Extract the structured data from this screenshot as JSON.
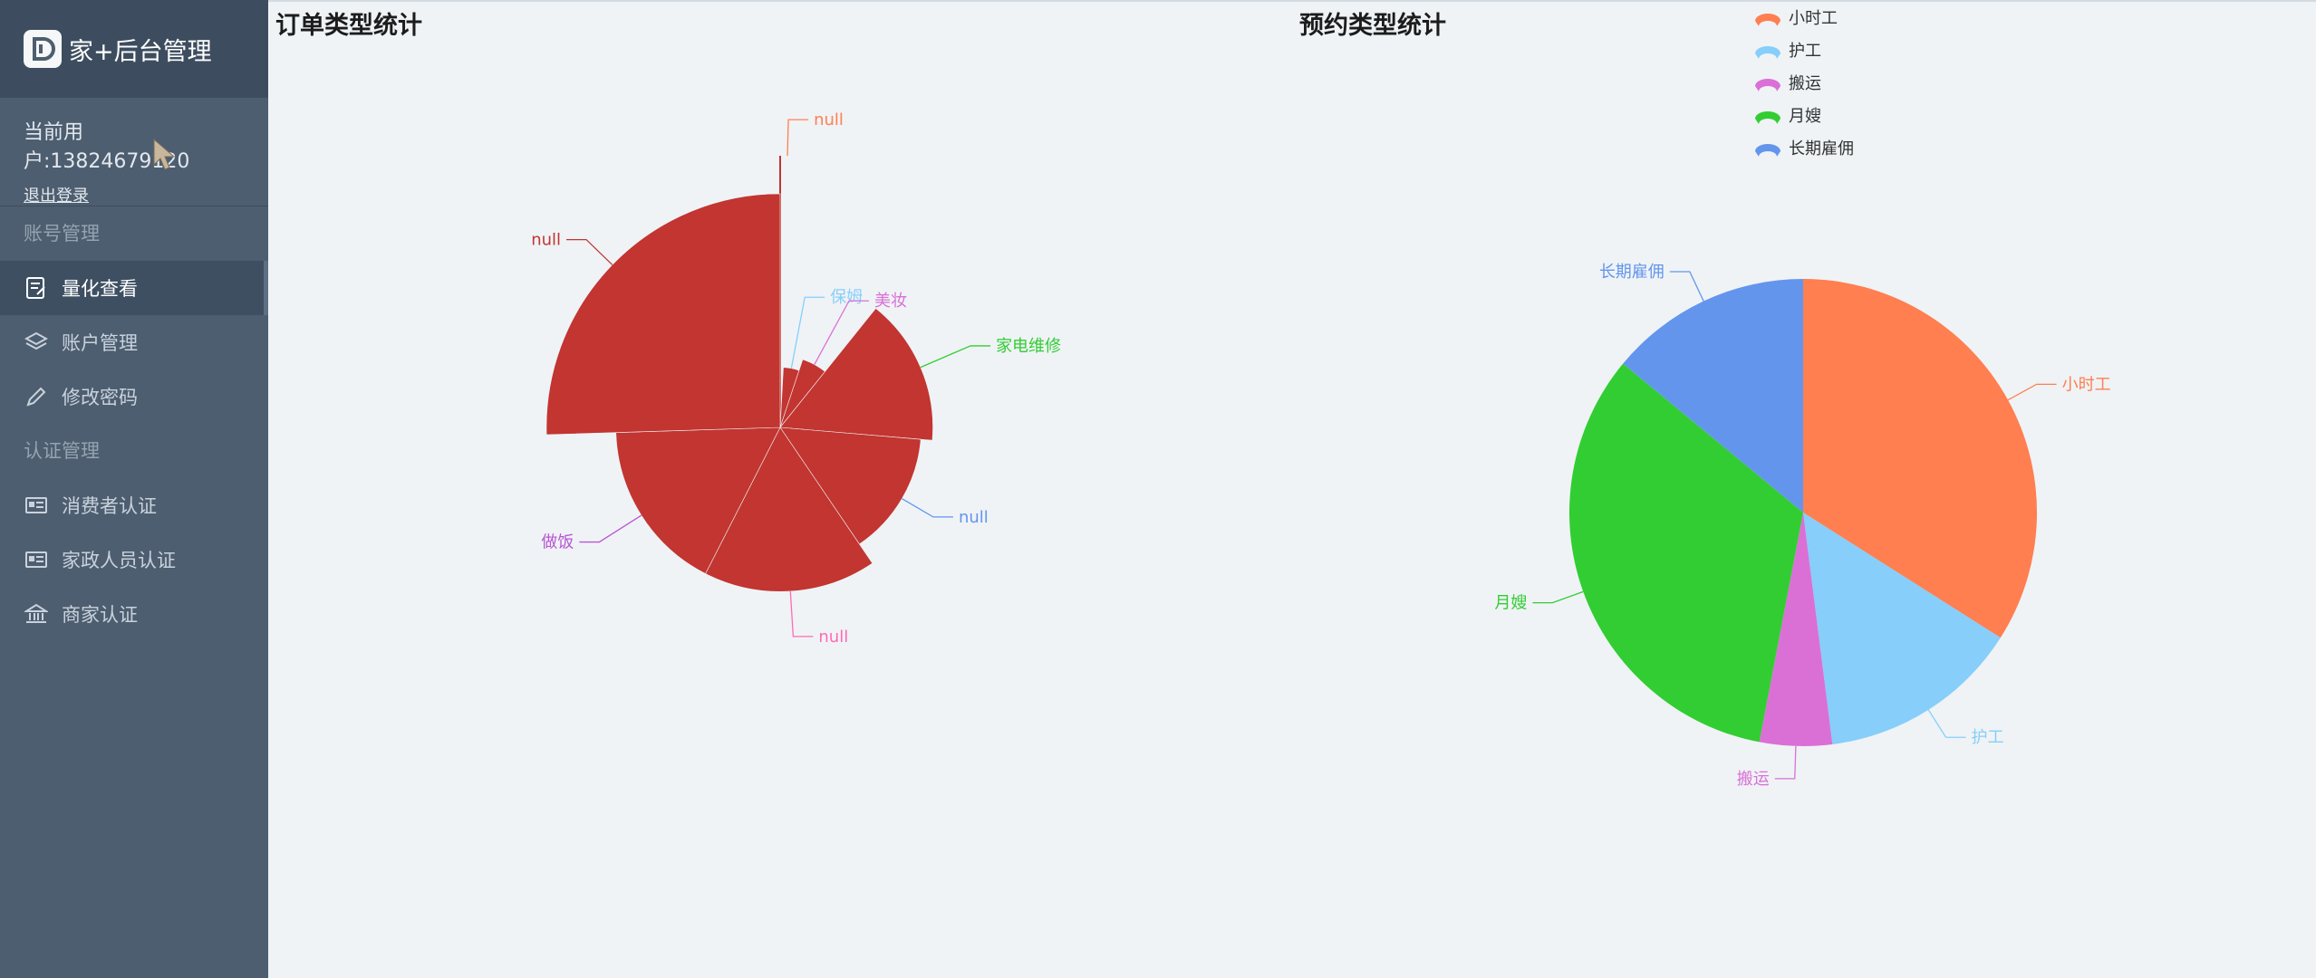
{
  "app": {
    "title": "家+后台管理"
  },
  "user": {
    "current_label": "当前用户:13824679120",
    "logout": "退出登录"
  },
  "nav": {
    "groups": [
      {
        "label": "账号管理",
        "items": [
          {
            "label": "量化查看",
            "icon": "report-icon",
            "active": true
          },
          {
            "label": "账户管理",
            "icon": "layers-icon",
            "active": false
          },
          {
            "label": "修改密码",
            "icon": "pen-icon",
            "active": false
          }
        ]
      },
      {
        "label": "认证管理",
        "items": [
          {
            "label": "消费者认证",
            "icon": "id-card-icon",
            "active": false
          },
          {
            "label": "家政人员认证",
            "icon": "id-card-icon",
            "active": false
          },
          {
            "label": "商家认证",
            "icon": "bank-icon",
            "active": false
          }
        ]
      }
    ]
  },
  "sections": {
    "order_title": "订单类型统计",
    "booking_title": "预约类型统计"
  },
  "colors": {
    "rose": "#c23531",
    "orange": "#ff7f50",
    "lightblue": "#87cefa",
    "orchid": "#da70d6",
    "green": "#32cd32",
    "blue": "#6495ed",
    "pink": "#ff69b4",
    "purple": "#ba55d3"
  },
  "chart_data": [
    {
      "type": "pie",
      "variant": "rose",
      "categories": [
        "null",
        "保姆",
        "美妆",
        "家电维修",
        "null",
        "null",
        "做饭",
        "null"
      ],
      "values": [
        0.6,
        3,
        4,
        11,
        10,
        12,
        12,
        18
      ],
      "label_colors": [
        "#ff7f50",
        "#87cefa",
        "#da70d6",
        "#32cd32",
        "#6495ed",
        "#ff69b4",
        "#ba55d3",
        "#c23531"
      ],
      "fill": "#c23531"
    },
    {
      "type": "pie",
      "categories": [
        "小时工",
        "护工",
        "搬运",
        "月嫂",
        "长期雇佣"
      ],
      "values": [
        34,
        14,
        5,
        33,
        14
      ],
      "colors": [
        "#ff7f50",
        "#87cefa",
        "#da70d6",
        "#32cd32",
        "#6495ed"
      ],
      "legend": [
        "小时工",
        "护工",
        "搬运",
        "月嫂",
        "长期雇佣"
      ],
      "legend_position": "top"
    }
  ]
}
